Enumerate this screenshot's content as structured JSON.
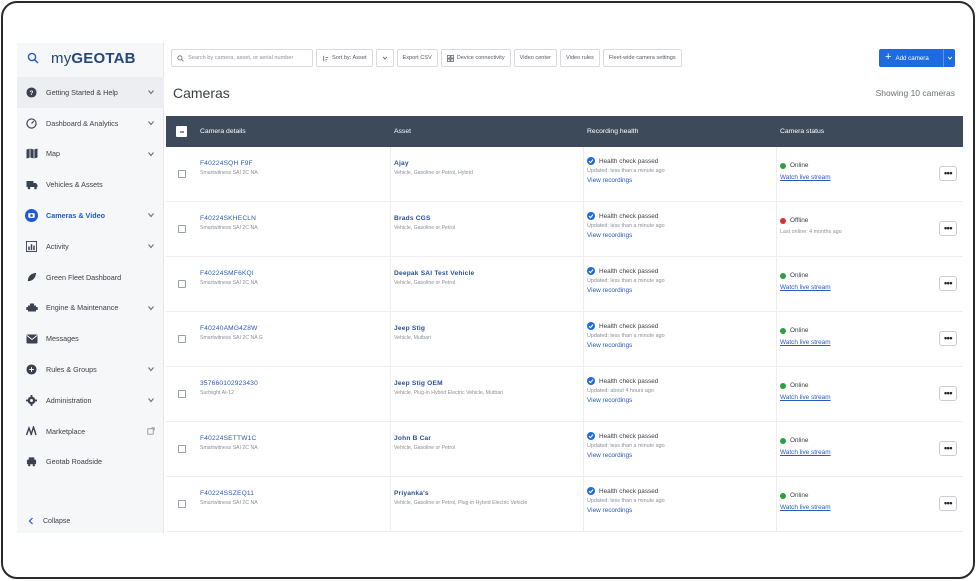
{
  "app": {
    "logo_text": "myGEOTAB",
    "logo_prefix": "my",
    "logo_rest": "GEOTAB"
  },
  "sidebar": {
    "items": [
      {
        "label": "Getting Started & Help",
        "icon": "help-circle-icon",
        "chevron": true
      },
      {
        "label": "Dashboard & Analytics",
        "icon": "gauge-icon",
        "chevron": true
      },
      {
        "label": "Map",
        "icon": "map-icon",
        "chevron": true
      },
      {
        "label": "Vehicles & Assets",
        "icon": "truck-icon",
        "chevron": false
      },
      {
        "label": "Cameras & Video",
        "icon": "camera-icon",
        "chevron": true
      },
      {
        "label": "Activity",
        "icon": "activity-icon",
        "chevron": true
      },
      {
        "label": "Green Fleet Dashboard",
        "icon": "leaf-icon",
        "chevron": false
      },
      {
        "label": "Engine & Maintenance",
        "icon": "engine-icon",
        "chevron": true
      },
      {
        "label": "Messages",
        "icon": "message-icon",
        "chevron": false
      },
      {
        "label": "Rules & Groups",
        "icon": "rules-icon",
        "chevron": true
      },
      {
        "label": "Administration",
        "icon": "gear-icon",
        "chevron": true
      },
      {
        "label": "Marketplace",
        "icon": "marketplace-icon",
        "chevron": false
      },
      {
        "label": "Geotab Roadside",
        "icon": "roadside-icon",
        "chevron": false
      }
    ],
    "collapse_label": "Collapse"
  },
  "toolbar": {
    "search_placeholder": "Search by camera, asset, or serial number",
    "sort_label": "Sort by: Asset",
    "export_label": "Export CSV",
    "connectivity_label": "Device connectivity",
    "video_center_label": "Video center",
    "video_rules_label": "Video rules",
    "fleet_settings_label": "Fleet-wide camera settings",
    "add_camera_label": "Add camera"
  },
  "page": {
    "title": "Cameras",
    "showing": "Showing 10 cameras"
  },
  "table": {
    "headers": {
      "camera": "Camera details",
      "asset": "Asset",
      "health": "Recording health",
      "status": "Camera status"
    },
    "rows": [
      {
        "serial": "F40224SQH F9F",
        "camera_type": "Smartwitness SAI 2C NA",
        "asset": "Ajay",
        "asset_sub": "Vehicle, Gasoline or Petrol, Hybrid",
        "health": "Health check passed",
        "updated": "Updated: less than a minute ago",
        "view": "View recordings",
        "status": "Online",
        "status_color": "#2e9e3f",
        "status_link": "Watch live stream"
      },
      {
        "serial": "F40224SKHECLN",
        "camera_type": "Smartwitness SAI 2C NA",
        "asset": "Brads CGS",
        "asset_sub": "Vehicle, Gasoline or Petrol",
        "health": "Health check passed",
        "updated": "Updated: less than a minute ago",
        "view": "View recordings",
        "status": "Offline",
        "status_color": "#d8302f",
        "status_link": "Last online: 4 months ago"
      },
      {
        "serial": "F40224SMF6KQI",
        "camera_type": "Smartwitness SAI 2C NA",
        "asset": "Deepak SAI Test Vehicle",
        "asset_sub": "Vehicle, Gasoline or Petrol",
        "health": "Health check passed",
        "updated": "Updated: less than a minute ago",
        "view": "View recordings",
        "status": "Online",
        "status_color": "#2e9e3f",
        "status_link": "Watch live stream"
      },
      {
        "serial": "F40240AMG4Z8W",
        "camera_type": "Smartwitness SAI 2C NA G",
        "asset": "Jeep Stig",
        "asset_sub": "Vehicle, Mutbari",
        "health": "Health check passed",
        "updated": "Updated: less than a minute ago",
        "view": "View recordings",
        "status": "Online",
        "status_color": "#2e9e3f",
        "status_link": "Watch live stream"
      },
      {
        "serial": "357660102923430",
        "camera_type": "Surfsight AI-12",
        "asset": "Jeep Stig OEM",
        "asset_sub": "Vehicle, Plug-in Hybrid Electric Vehicle, Mutbari",
        "health": "Health check passed",
        "updated": "Updated: about 4 hours ago",
        "view": "View recordings",
        "status": "Online",
        "status_color": "#2e9e3f",
        "status_link": "Watch live stream"
      },
      {
        "serial": "F40224SETTW1C",
        "camera_type": "Smartwitness SAI 2C NA",
        "asset": "John B Car",
        "asset_sub": "Vehicle, Gasoline or Petrol",
        "health": "Health check passed",
        "updated": "Updated: less than a minute ago",
        "view": "View recordings",
        "status": "Online",
        "status_color": "#2e9e3f",
        "status_link": "Watch live stream"
      },
      {
        "serial": "F40224SSZEQ11",
        "camera_type": "Smartwitness SAI 2C NA",
        "asset": "Priyanka's",
        "asset_sub": "Vehicle, Gasoline or Petrol, Plug-in Hybrid Electric Vehicle",
        "health": "Health check passed",
        "updated": "Updated: less than a minute ago",
        "view": "View recordings",
        "status": "Online",
        "status_color": "#2e9e3f",
        "status_link": "Watch live stream"
      }
    ]
  },
  "colors": {
    "accent": "#1e6be0",
    "header_bg": "#3d4a5a",
    "link": "#2a59b8",
    "online": "#2e9e3f",
    "offline": "#d8302f"
  }
}
